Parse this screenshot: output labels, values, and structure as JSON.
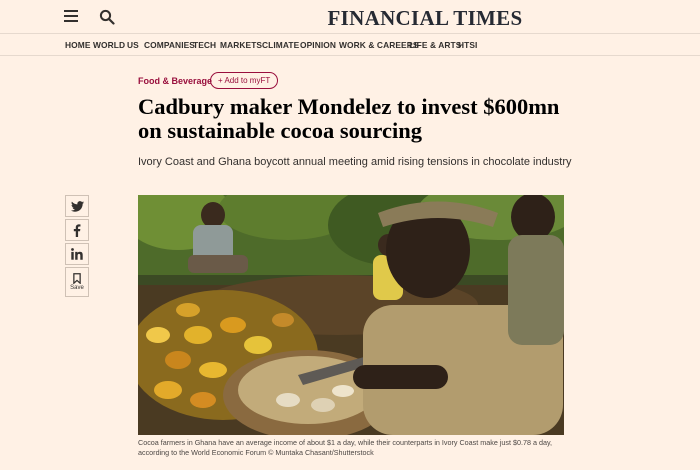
{
  "header": {
    "masthead": "FINANCIAL TIMES",
    "menu_icon": "hamburger-icon",
    "search_icon": "search-icon"
  },
  "nav": {
    "items": [
      "HOME",
      "WORLD",
      "US",
      "COMPANIES",
      "TECH",
      "MARKETS",
      "CLIMATE",
      "OPINION",
      "WORK & CAREERS",
      "LIFE & ARTS",
      "HTSI"
    ]
  },
  "article": {
    "section": "Food & Beverage",
    "myft_label": "+ Add to myFT",
    "headline_line1": "Cadbury maker Mondelez to invest $600mn",
    "headline_line2": "on sustainable cocoa sourcing",
    "standfirst": "Ivory Coast and Ghana boycott annual meeting amid rising tensions in chocolate industry",
    "caption_line1": "Cocoa farmers in Ghana have an average income of about $1 a day, while their counterparts in Ivory Coast make just $0.78 a day,",
    "caption_line2": "according to the World Economic Forum © Muntaka Chasant/Shutterstock"
  },
  "share": {
    "save_label": "Save",
    "icons": [
      "twitter-icon",
      "facebook-icon",
      "linkedin-icon",
      "bookmark-icon"
    ]
  },
  "colors": {
    "background": "#fff1e5",
    "accent": "#990f3d",
    "text": "#33302e"
  }
}
